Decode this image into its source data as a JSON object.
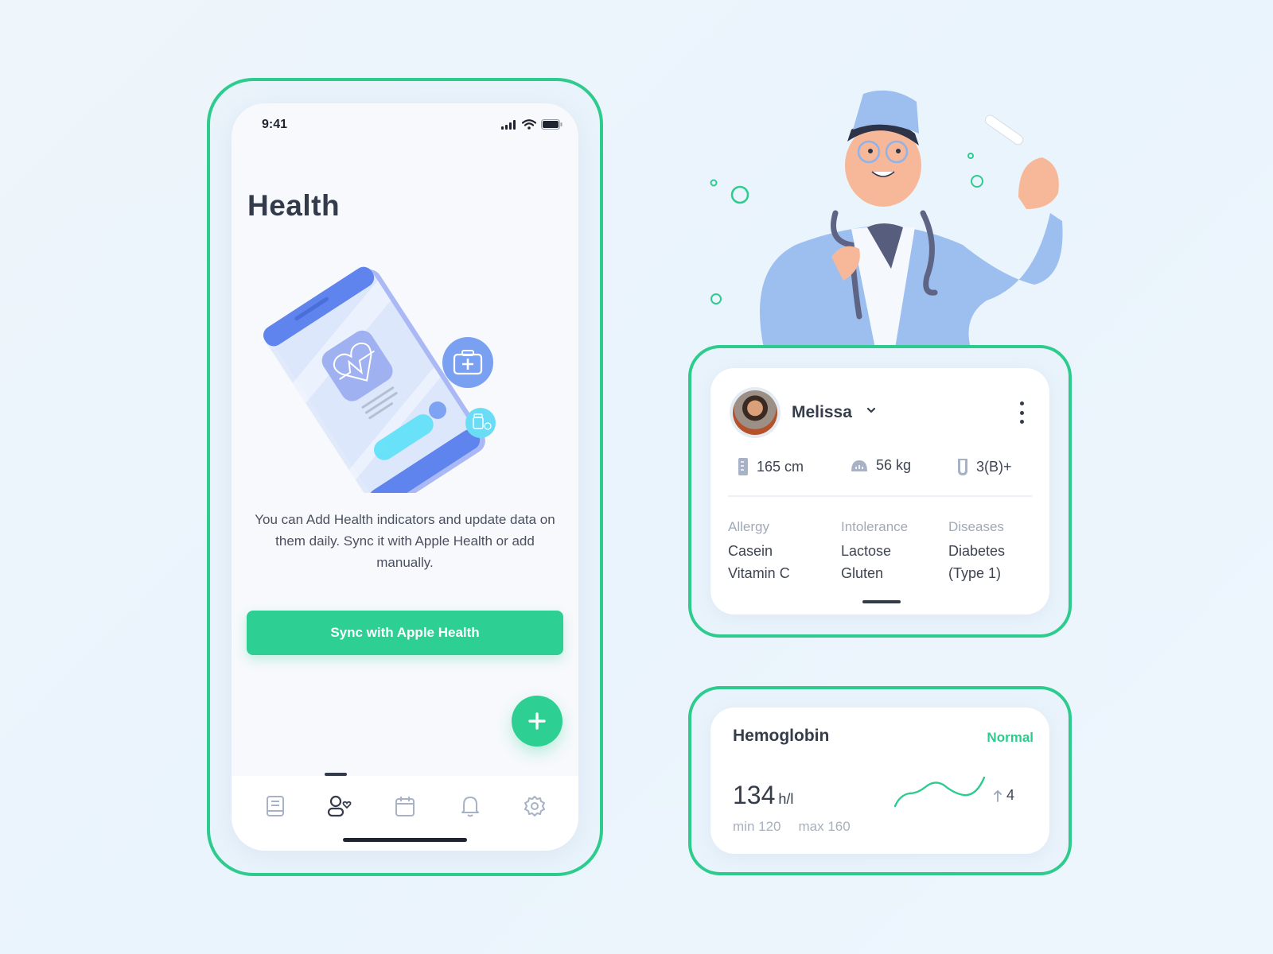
{
  "phone": {
    "status_bar": {
      "time": "9:41",
      "icons": [
        "signal-icon",
        "wifi-icon",
        "battery-icon"
      ]
    },
    "title": "Health",
    "hero_icons": [
      "phone-heart-illustration",
      "first-aid-kit-icon",
      "pill-bottle-icon"
    ],
    "description": "You can Add Health indicators and update data on them daily. Sync it with Apple Health or add manually.",
    "sync_button_label": "Sync with Apple Health",
    "fab_icon": "plus-icon",
    "tabs": [
      {
        "name": "records",
        "icon": "document-icon",
        "active": false
      },
      {
        "name": "profile",
        "icon": "user-heart-icon",
        "active": true
      },
      {
        "name": "calendar",
        "icon": "calendar-icon",
        "active": false
      },
      {
        "name": "notifications",
        "icon": "bell-icon",
        "active": false
      },
      {
        "name": "settings",
        "icon": "gear-icon",
        "active": false
      }
    ]
  },
  "profile": {
    "name": "Melissa",
    "stats": [
      {
        "icon": "height-ruler-icon",
        "value": "165 cm"
      },
      {
        "icon": "weight-scale-icon",
        "value": "56 kg"
      },
      {
        "icon": "blood-tube-icon",
        "value": "3(B)+"
      }
    ],
    "sections": [
      {
        "heading": "Allergy",
        "items": [
          "Casein",
          "Vitamin C"
        ]
      },
      {
        "heading": "Intolerance",
        "items": [
          "Lactose",
          "Gluten"
        ]
      },
      {
        "heading": "Diseases",
        "items": [
          "Diabetes",
          "(Type 1)"
        ]
      }
    ]
  },
  "hemoglobin": {
    "title": "Hemoglobin",
    "status": "Normal",
    "value": "134",
    "unit": "h/l",
    "min_label": "min 120",
    "max_label": "max 160",
    "delta": "4",
    "delta_direction": "up"
  },
  "colors": {
    "accent": "#2dcf93",
    "outline": "#2dcc8e",
    "text_dark": "#353c4a",
    "text_muted": "#a1a9b8",
    "illustration_blue": "#6b8ff0"
  }
}
